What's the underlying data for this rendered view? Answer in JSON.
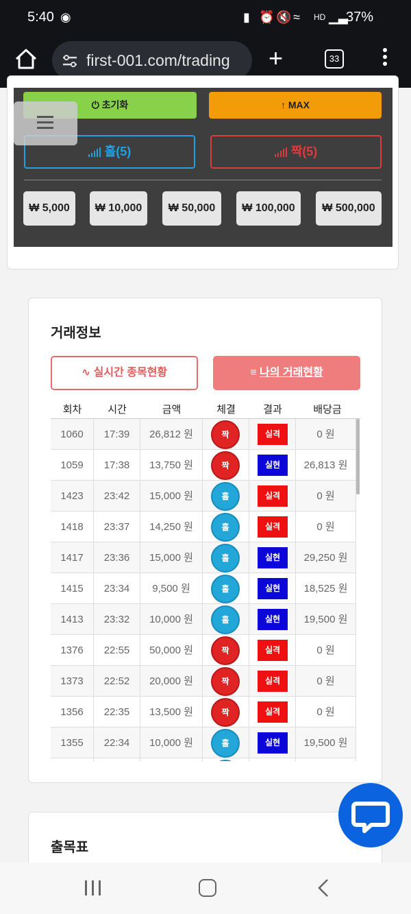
{
  "status_bar": {
    "time": "5:40",
    "battery": "37%"
  },
  "browser": {
    "url": "first-001.com/trading",
    "tab_count": "33"
  },
  "controls": {
    "reset_label": "초기화",
    "max_label": "MAX",
    "odd_label": "홀(5)",
    "even_label": "짝(5)",
    "amounts": [
      "₩ 5,000",
      "₩ 10,000",
      "₩ 50,000",
      "₩ 100,000",
      "₩ 500,000"
    ]
  },
  "trade_info": {
    "title": "거래정보",
    "tab_live": "실시간 종목현황",
    "tab_mine": "나의 거래현황",
    "columns": [
      "회차",
      "시간",
      "금액",
      "체결",
      "결과",
      "배당금"
    ],
    "rows": [
      {
        "round": "1060",
        "time": "17:39",
        "amount": "26,812 원",
        "pick": "짝",
        "pick_type": "even",
        "result": "실격",
        "result_type": "fail",
        "payout": "0 원"
      },
      {
        "round": "1059",
        "time": "17:38",
        "amount": "13,750 원",
        "pick": "짝",
        "pick_type": "even",
        "result": "실현",
        "result_type": "win",
        "payout": "26,813 원"
      },
      {
        "round": "1423",
        "time": "23:42",
        "amount": "15,000 원",
        "pick": "홀",
        "pick_type": "odd",
        "result": "실격",
        "result_type": "fail",
        "payout": "0 원"
      },
      {
        "round": "1418",
        "time": "23:37",
        "amount": "14,250 원",
        "pick": "홀",
        "pick_type": "odd",
        "result": "실격",
        "result_type": "fail",
        "payout": "0 원"
      },
      {
        "round": "1417",
        "time": "23:36",
        "amount": "15,000 원",
        "pick": "홀",
        "pick_type": "odd",
        "result": "실현",
        "result_type": "win",
        "payout": "29,250 원"
      },
      {
        "round": "1415",
        "time": "23:34",
        "amount": "9,500 원",
        "pick": "홀",
        "pick_type": "odd",
        "result": "실현",
        "result_type": "win",
        "payout": "18,525 원"
      },
      {
        "round": "1413",
        "time": "23:32",
        "amount": "10,000 원",
        "pick": "홀",
        "pick_type": "odd",
        "result": "실현",
        "result_type": "win",
        "payout": "19,500 원"
      },
      {
        "round": "1376",
        "time": "22:55",
        "amount": "50,000 원",
        "pick": "짝",
        "pick_type": "even",
        "result": "실격",
        "result_type": "fail",
        "payout": "0 원"
      },
      {
        "round": "1373",
        "time": "22:52",
        "amount": "20,000 원",
        "pick": "짝",
        "pick_type": "even",
        "result": "실격",
        "result_type": "fail",
        "payout": "0 원"
      },
      {
        "round": "1356",
        "time": "22:35",
        "amount": "13,500 원",
        "pick": "짝",
        "pick_type": "even",
        "result": "실격",
        "result_type": "fail",
        "payout": "0 원"
      },
      {
        "round": "1355",
        "time": "22:34",
        "amount": "10,000 원",
        "pick": "홀",
        "pick_type": "odd",
        "result": "실현",
        "result_type": "win",
        "payout": "19,500 원"
      },
      {
        "round": "",
        "time": "",
        "amount": "",
        "pick": "",
        "pick_type": "odd",
        "result": "",
        "result_type": "none",
        "payout": ""
      }
    ]
  },
  "schedule": {
    "title": "출목표"
  }
}
